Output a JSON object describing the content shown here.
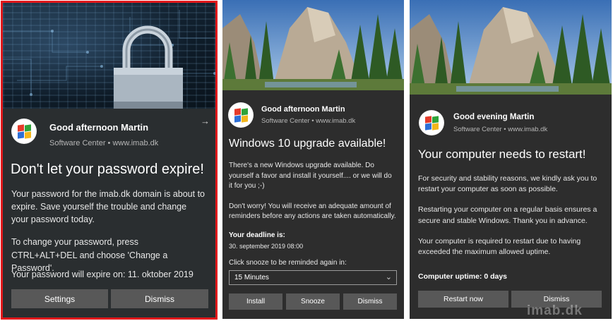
{
  "toasts": [
    {
      "sender": "Good afternoon Martin",
      "source": "Software Center • www.imab.dk",
      "headline": "Don't let your password expire!",
      "body": [
        "Your password for the imab.dk domain is about to expire. Save yourself the trouble and change your password today.",
        "To change your password, press CTRL+ALT+DEL and choose 'Change a Password'."
      ],
      "expire_text": "Your password will expire on:  11. oktober 2019",
      "buttons": [
        "Settings",
        "Dismiss"
      ]
    },
    {
      "sender": "Good afternoon Martin",
      "source": "Software Center • www.imab.dk",
      "headline": "Windows 10 upgrade available!",
      "body": [
        "There's a new Windows upgrade available. Do yourself a favor and install it yourself.... or we will do it for you ;-)",
        "Don't worry! You will receive an adequate amount of reminders before any actions are taken automatically."
      ],
      "deadline_label": "Your deadline is:",
      "deadline_value": "30. september 2019 08:00",
      "snooze_label": "Click snooze to be reminded again in:",
      "snooze_selected": "15 Minutes",
      "buttons": [
        "Install",
        "Snooze",
        "Dismiss"
      ]
    },
    {
      "sender": "Good evening Martin",
      "source": "Software Center • www.imab.dk",
      "headline": "Your computer needs to restart!",
      "body": [
        "For security and stability reasons, we kindly ask you to restart your computer as soon as possible.",
        "Restarting your computer on a regular basis ensures a secure and stable Windows. Thank you in advance.",
        "Your computer is required to restart due to having exceeded the maximum allowed uptime."
      ],
      "uptime": "Computer uptime: 0 days",
      "buttons": [
        "Restart now",
        "Dismiss"
      ],
      "watermark": "imab.dk"
    }
  ],
  "icons": {
    "app": "windows-logo-icon",
    "expand": "arrow-right-icon",
    "dropdown": "chevron-down-icon"
  },
  "colors": {
    "highlight_border": "#e0181b",
    "toast_bg": "#2d2d2d",
    "button_bg": "#585858"
  }
}
